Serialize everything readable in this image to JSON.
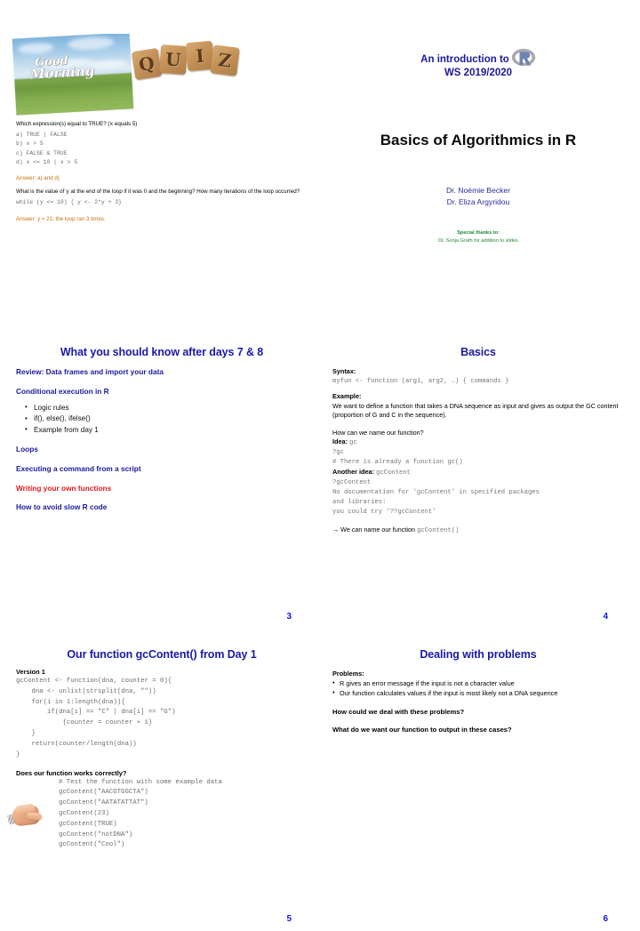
{
  "document": {
    "kind": "lecture-slide-handout",
    "colors": {
      "title_blue": "#1a1a9e",
      "accent_red": "#e01b1b",
      "answer_orange": "#c8700f",
      "thanks_green": "#1f8a34",
      "code_gray": "#6e6e6e",
      "page_number_blue": "#1414e0"
    }
  },
  "slide1": {
    "images": {
      "good_morning": {
        "name": "good-morning-photo",
        "line1": "Good",
        "line2": "Morning"
      },
      "quiz_blocks": {
        "name": "quiz-wooden-blocks",
        "letters": [
          "Q",
          "U",
          "I",
          "Z"
        ]
      }
    },
    "question1": {
      "prompt_before": "Which expression(s) equal to TRUE? (",
      "prompt_var": "x",
      "prompt_after": " equals 5)",
      "options": [
        "a) TRUE | FALSE",
        "b)  x > 5",
        "c)  FALSE & TRUE",
        "d)  x <= 10 | x > 5"
      ],
      "answer": "Answer: a) and d)"
    },
    "question2": {
      "prompt_part1": "What is the value of ",
      "prompt_var": "y",
      "prompt_part2": " at the end of the loop if it was 0 and the beginning? How many iterations of the loop occurred?",
      "code": "while (y <= 10) { y <- 2*y + 3}",
      "answer": "Answer: y = 21; the loop ran 3 times."
    }
  },
  "slide2": {
    "header_line1": "An introduction to",
    "header_line2": "WS 2019/2020",
    "logo_alt": "R",
    "main_title": "Basics of Algorithmics in R",
    "authors": [
      "Dr. Noémie Becker",
      "Dr. Eliza Argyridou"
    ],
    "thanks_title": "Special thanks to:",
    "thanks_body": "Dr. Sonja Grath for addition to slides"
  },
  "slide3": {
    "title": "What you should know after days 7 & 8",
    "items": [
      {
        "label": "Review: Data frames and import your data",
        "style": "blue"
      },
      {
        "label": "Conditional execution in R",
        "style": "blue"
      },
      {
        "label": "Loops",
        "style": "blue"
      },
      {
        "label": "Executing a command from a script",
        "style": "blue"
      },
      {
        "label": "Writing your own functions",
        "style": "red"
      },
      {
        "label": "How to avoid slow R code",
        "style": "blue"
      }
    ],
    "sub_items": [
      "Logic rules",
      "if(), else(), ifelse()",
      "Example from day 1"
    ],
    "page_number": "3"
  },
  "slide4": {
    "title": "Basics",
    "syntax_label": "Syntax:",
    "syntax_code": "myfun <- function (arg1, arg2, …) { commands }",
    "example_label": "Example:",
    "example_text": "We want to define a function that takes a DNA sequence as input and gives as output the GC content (proportion of G and C in the sequence).",
    "naming_question": "How can we name our function?",
    "idea_label": "Idea:",
    "idea_code": "gc",
    "console1": "?gc\n# There is already a function gc()",
    "another_idea_label": "Another idea:",
    "another_idea_code": "gcContent",
    "console2": "?gcContent\nNo documentation for 'gcContent' in specified packages\nand libraries:\nyou could try ‘??gcContent’",
    "conclusion_prefix": "→ We can name our function ",
    "conclusion_code": "gcContent()",
    "page_number": "4"
  },
  "slide5": {
    "title": "Our function gcContent() from Day 1",
    "version_label": "Version 1",
    "code": "gcContent <- function(dna, counter = 0){\n    dna <- unlist(strsplit(dna, \"\"))\n    for(i in 1:length(dna)){\n        if(dna[i] == \"C\" | dna[i] == \"G\")\n            {counter = counter + 1}\n    }\n    return(counter/length(dna))\n}",
    "test_label": "Does our function works correctly?",
    "test_code": "# Test the function with some example data\ngcContent(\"AACGTGGCTA\")\ngcContent(\"AATATATTAT\")\ngcContent(23)\ngcContent(TRUE)\ngcContent(\"notDNA\")\ngcContent(\"Cool\")",
    "hand_icon": "pointing-hand-icon",
    "page_number": "5"
  },
  "slide6": {
    "title": "Dealing with problems",
    "problems_label": "Problems:",
    "problems": [
      "R gives an error message if the input is not a character value",
      "Our function calculates values if the input is most likely not a DNA sequence"
    ],
    "question1": "How could we deal with these problems?",
    "question2": "What do we want our function to output in these cases?",
    "page_number": "6"
  }
}
